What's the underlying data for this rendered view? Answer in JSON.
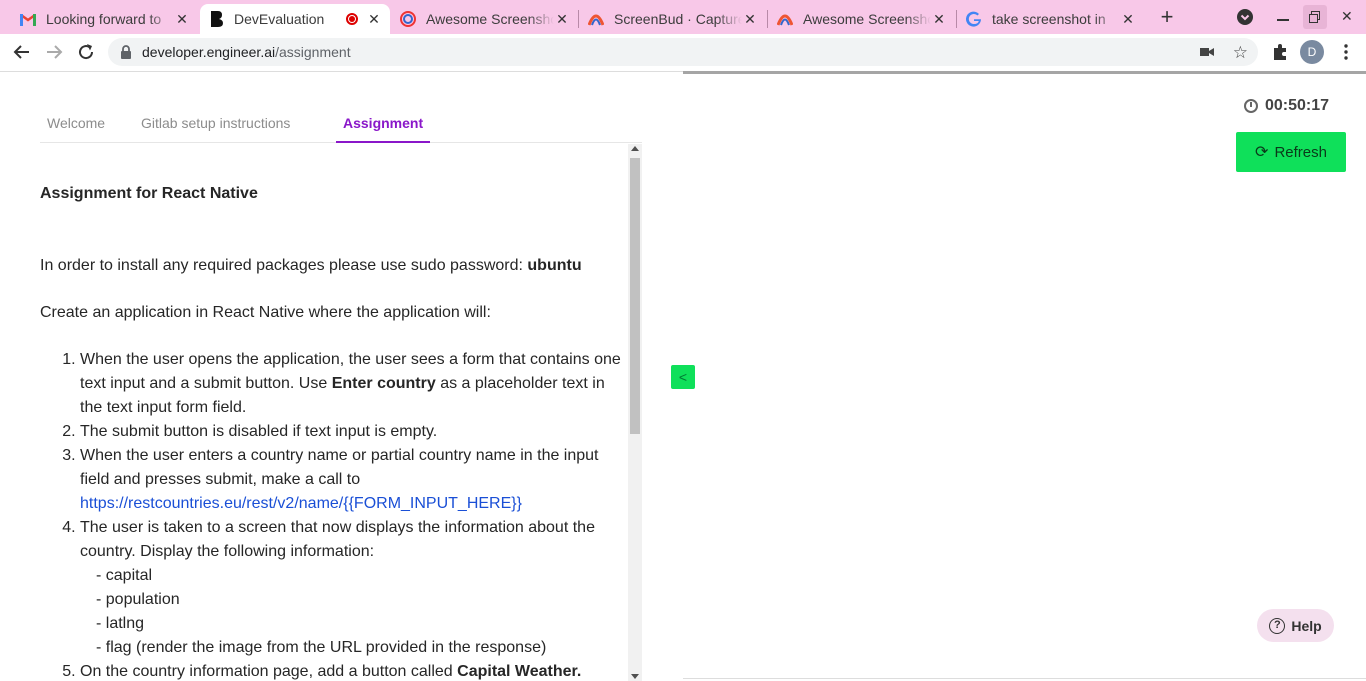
{
  "browser": {
    "tabs": [
      {
        "title": "Looking forward to",
        "favicon": "gmail-icon"
      },
      {
        "title": "DevEvaluation",
        "favicon": "engineer-ai-icon",
        "active": true,
        "recording": true
      },
      {
        "title": "Awesome Screenshot",
        "favicon": "awesome-screenshot-icon"
      },
      {
        "title": "ScreenBud · Capture",
        "favicon": "screenbud-icon"
      },
      {
        "title": "Awesome Screenshot",
        "favicon": "screenbud-icon"
      },
      {
        "title": "take screenshot in",
        "favicon": "google-icon"
      }
    ],
    "address": {
      "host": "developer.engineer.ai",
      "path": "/assignment"
    },
    "profile_initial": "D"
  },
  "nav": {
    "tabs": [
      "Welcome",
      "Gitlab setup instructions",
      "Assignment"
    ],
    "active": "Assignment"
  },
  "assignment": {
    "title": "Assignment for React Native",
    "install_note": "In order to install any required packages please use sudo password:",
    "password": "ubuntu",
    "intro": "Create an application in React Native where the application will:",
    "steps": {
      "s1_pre": "When the user opens the application, the user sees a form that contains one text input and a submit button. Use",
      "s1_bold": "Enter country",
      "s1_post": "as a placeholder text in the text input form field.",
      "s2": "The submit button is disabled if text input is empty.",
      "s3_pre": "When the user enters a country name or partial country name in the input field and presses submit, make a call to",
      "s3_link": "https://restcountries.eu/rest/v2/name/{{FORM_INPUT_HERE}}",
      "s4": "The user is taken to a screen that now displays the information about the country. Display the following information:",
      "s4_items": [
        "- capital",
        "- population",
        "- latlng",
        "- flag (render the image from the URL provided in the response)"
      ],
      "s5_pre": "On the country information page, add a button called",
      "s5_bold": "Capital Weather."
    }
  },
  "timer": "00:50:17",
  "refresh_label": "Refresh",
  "help_label": "Help",
  "collapse_label": "<",
  "colors": {
    "accent": "#8a17c9",
    "green": "#0fe05a",
    "tabstrip": "#f8c8e8",
    "link": "#1a4fd6"
  }
}
